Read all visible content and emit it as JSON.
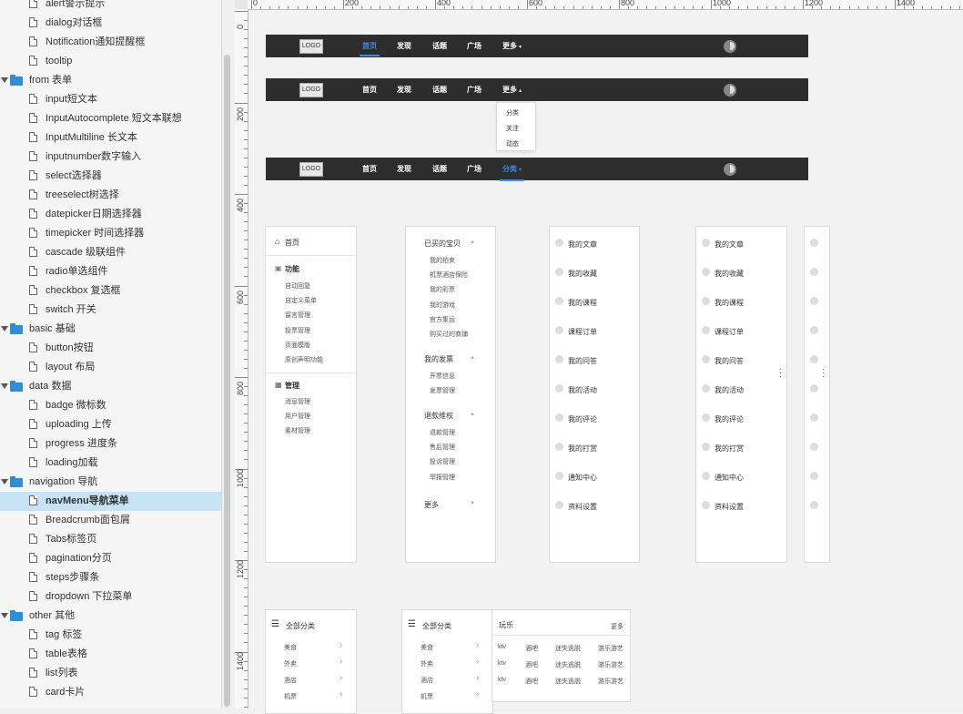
{
  "tree": {
    "rows": [
      {
        "type": "page",
        "label": "alert警示提示"
      },
      {
        "type": "page",
        "label": "dialog对话框"
      },
      {
        "type": "page",
        "label": "Notification通知提醒框"
      },
      {
        "type": "page",
        "label": "tooltip"
      },
      {
        "type": "folder",
        "label": "from 表单"
      },
      {
        "type": "page",
        "label": "input短文本"
      },
      {
        "type": "page",
        "label": "InputAutocomplete 短文本联想"
      },
      {
        "type": "page",
        "label": "InputMultiline 长文本"
      },
      {
        "type": "page",
        "label": "inputnumber数字输入"
      },
      {
        "type": "page",
        "label": "select选择器"
      },
      {
        "type": "page",
        "label": "treeselect树选择"
      },
      {
        "type": "page",
        "label": "datepicker日期选择器"
      },
      {
        "type": "page",
        "label": "timepicker 时间选择器"
      },
      {
        "type": "page",
        "label": "cascade 级联组件"
      },
      {
        "type": "page",
        "label": "radio单选组件"
      },
      {
        "type": "page",
        "label": "checkbox 复选框"
      },
      {
        "type": "page",
        "label": "switch 开关"
      },
      {
        "type": "folder",
        "label": "basic 基础"
      },
      {
        "type": "page",
        "label": "button按钮"
      },
      {
        "type": "page",
        "label": "layout 布局"
      },
      {
        "type": "folder",
        "label": "data 数据"
      },
      {
        "type": "page",
        "label": "badge 微标数"
      },
      {
        "type": "page",
        "label": "uploading 上传"
      },
      {
        "type": "page",
        "label": "progress 进度条"
      },
      {
        "type": "page",
        "label": "loading加载"
      },
      {
        "type": "folder",
        "label": "navigation 导航"
      },
      {
        "type": "page",
        "label": "navMenu导航菜单",
        "selected": true
      },
      {
        "type": "page",
        "label": "Breadcrumb面包屑"
      },
      {
        "type": "page",
        "label": "Tabs标签页"
      },
      {
        "type": "page",
        "label": "pagination分页"
      },
      {
        "type": "page",
        "label": "steps步骤条"
      },
      {
        "type": "page",
        "label": "dropdown 下拉菜单"
      },
      {
        "type": "folder",
        "label": "other 其他"
      },
      {
        "type": "page",
        "label": "tag 标签"
      },
      {
        "type": "page",
        "label": "table表格"
      },
      {
        "type": "page",
        "label": "list列表"
      },
      {
        "type": "page",
        "label": "card卡片"
      }
    ]
  },
  "ruler": {
    "h_labels": [
      "0",
      "200",
      "400",
      "600",
      "800",
      "1000",
      "1200",
      "1400"
    ],
    "v_labels": [
      "0",
      "200",
      "400",
      "600",
      "800",
      "1000",
      "1200",
      "1400"
    ]
  },
  "navbar": {
    "logo": "LOGO",
    "items": [
      "首页",
      "发现",
      "话题",
      "广场",
      "更多"
    ],
    "alt_last": "分类",
    "dropdown": [
      "分类",
      "关注",
      "动态"
    ]
  },
  "sidenav1": {
    "home": "首页",
    "func_title": "功能",
    "func_items": [
      "自动回复",
      "自定义菜单",
      "留言管理",
      "投票管理",
      "页面模版",
      "原创声明功能"
    ],
    "manage_title": "管理",
    "manage_items": [
      "消息管理",
      "用户管理",
      "素材管理"
    ]
  },
  "sidenav2": {
    "groups": [
      {
        "title": "已买的宝贝",
        "items": [
          "我的拍卖",
          "机票酒店保险",
          "我的彩票",
          "我的游戏",
          "官方集运",
          "购买过的商铺"
        ]
      },
      {
        "title": "我的发票",
        "items": [
          "开票信息",
          "发票管理"
        ]
      },
      {
        "title": "退款维权",
        "items": [
          "退款管理",
          "售后管理",
          "投诉管理",
          "举报管理"
        ]
      }
    ],
    "more": "更多"
  },
  "iconlist": {
    "items": [
      "我的文章",
      "我的收藏",
      "我的课程",
      "课程订单",
      "我的问答",
      "我的活动",
      "我的评论",
      "我的打赏",
      "通知中心",
      "资料设置"
    ]
  },
  "category": {
    "title": "全部分类",
    "items": [
      "美食",
      "外卖",
      "酒店",
      "机票"
    ]
  },
  "catpanel": {
    "title": "玩乐",
    "more": "更多",
    "rows": [
      [
        "ktv",
        "酒吧",
        "迷失逃脱",
        "游乐游艺"
      ],
      [
        "ktv",
        "酒吧",
        "迷失逃脱",
        "游乐游艺"
      ],
      [
        "ktv",
        "酒吧",
        "迷失逃脱",
        "游乐游艺"
      ]
    ]
  },
  "colors": {
    "navbar_bg": "#2d2d2d",
    "accent": "#3a8ee6",
    "selection": "#c5e3f5",
    "folder": "#2d8ed5"
  }
}
